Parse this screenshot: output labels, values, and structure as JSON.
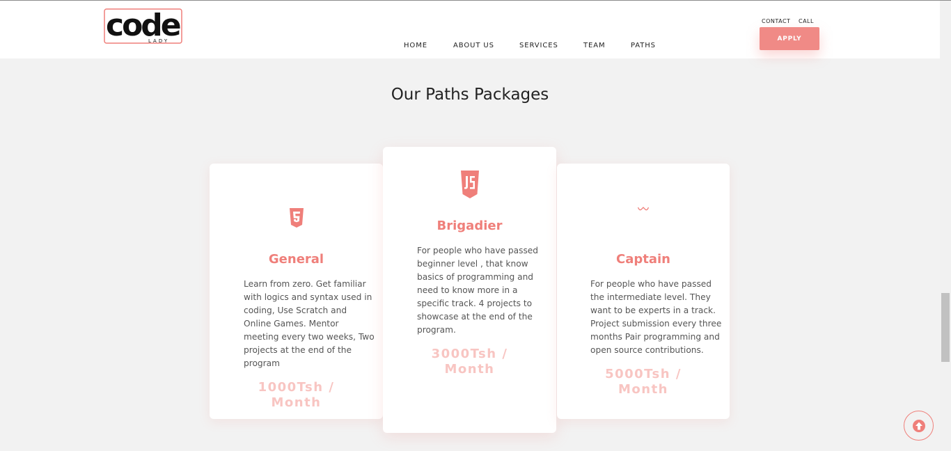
{
  "header": {
    "logo": {
      "main_text": "code",
      "sub_text": "LADY"
    },
    "nav": [
      {
        "label": "HOME"
      },
      {
        "label": "ABOUT US"
      },
      {
        "label": "SERVICES"
      },
      {
        "label": "TEAM"
      },
      {
        "label": "PATHS"
      }
    ],
    "top_links": [
      {
        "label": "CONTACT"
      },
      {
        "label": "CALL"
      }
    ],
    "apply_label": "APPLY"
  },
  "section": {
    "title": "Our Paths Packages"
  },
  "packages": [
    {
      "icon": "html5-icon",
      "title": "General",
      "description": "Learn from zero. Get familiar with logics and syntax used in coding, Use Scratch and Online Games. Mentor meeting every two weeks, Two projects at the end of the program",
      "price_line1": "1000Tsh /",
      "price_line2": "Month"
    },
    {
      "icon": "javascript-icon",
      "title": "Brigadier",
      "description": "For people who have passed beginner level , that know basics of programming and need to know more in a specific track. 4 projects to showcase at the end of the program.",
      "price_line1": "3000Tsh /",
      "price_line2": "Month"
    },
    {
      "icon": "wave-icon",
      "title": "Captain",
      "description": "For people who have passed the intermediate level. They want to be experts in a track. Project submission every three months Pair programming and open source contributions.",
      "price_line1": "5000Tsh /",
      "price_line2": "Month"
    }
  ],
  "colors": {
    "accent": "#ef7f7a",
    "price": "#f8c5c2",
    "background": "#f2f2f2",
    "card": "#ffffff"
  }
}
